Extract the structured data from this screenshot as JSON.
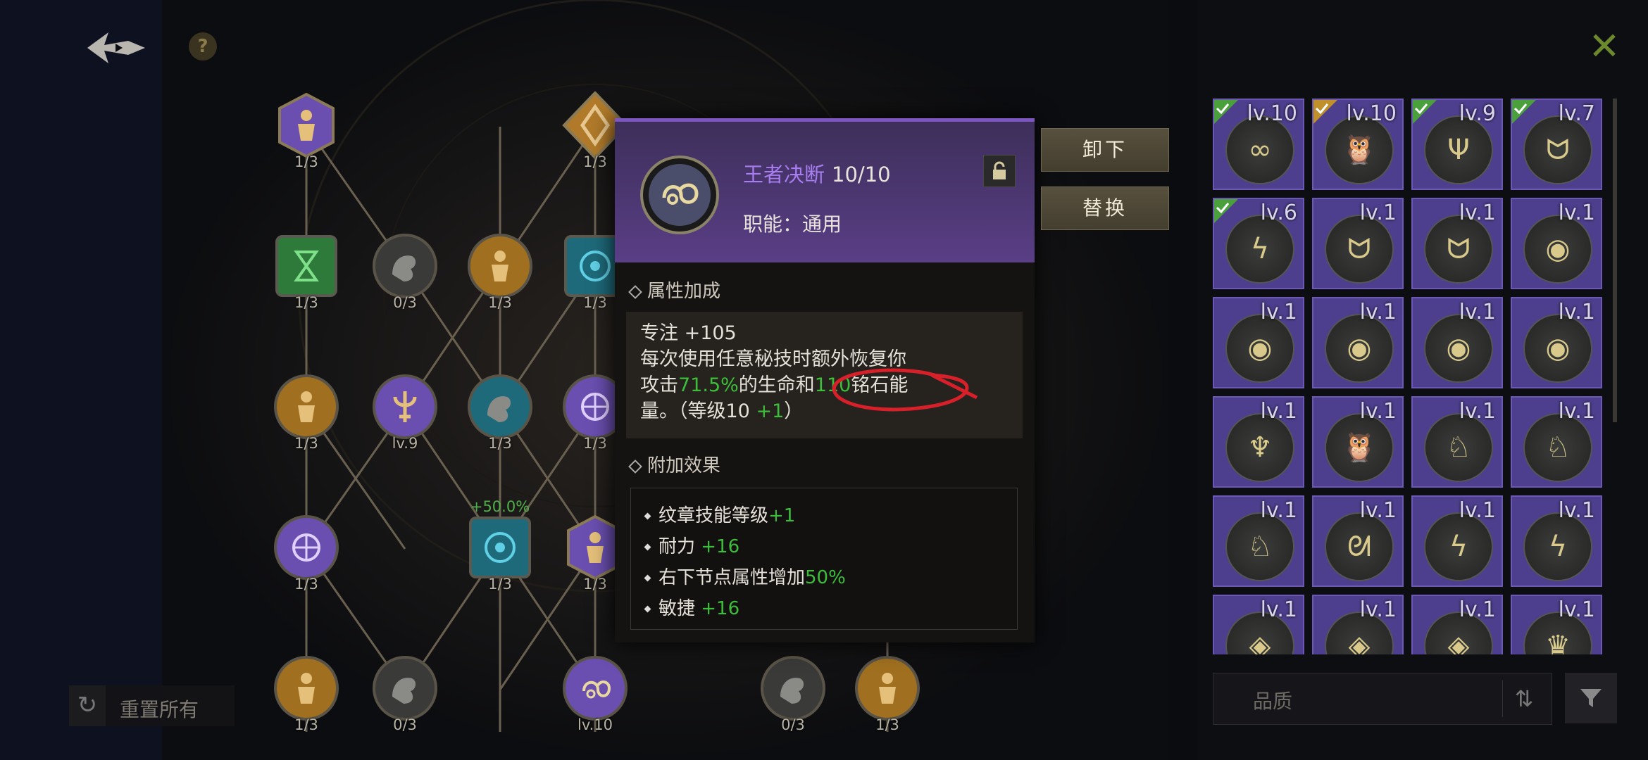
{
  "header": {
    "help_label": "?",
    "close_label": "✕"
  },
  "tree_nodes": [
    {
      "label": "1/3",
      "type": "figure",
      "color": "#6a4fb0"
    },
    {
      "label": "1/3",
      "type": "diamond",
      "color": "#b07a2a"
    },
    {
      "label": "1/3",
      "type": "hourglass",
      "color": "#2e7a3a"
    },
    {
      "label": "0/3",
      "type": "arm",
      "color": "#3a3a38"
    },
    {
      "label": "1/3",
      "type": "figure",
      "color": "#a07020"
    },
    {
      "label": "1/3",
      "type": "target",
      "color": "#1e6a7a"
    },
    {
      "label": "1/3",
      "type": "figure",
      "color": "#a07020"
    },
    {
      "label": "lv.9",
      "type": "trident",
      "color": "#6a4fb0"
    },
    {
      "label": "1/3",
      "type": "arm",
      "color": "#1e6a7a"
    },
    {
      "label": "1/3",
      "type": "compass",
      "color": "#6a4fb0"
    },
    {
      "label": "1/3",
      "type": "compass",
      "color": "#6a4fb0"
    },
    {
      "label": "1/3",
      "type": "target",
      "color": "#1e6a7a",
      "bonus": "+50.0%"
    },
    {
      "label": "1/3",
      "type": "figure",
      "color": "#6a4fb0"
    },
    {
      "label": "1/3",
      "type": "figure",
      "color": "#a07020"
    },
    {
      "label": "0/3",
      "type": "arm",
      "color": "#3a3a38"
    },
    {
      "label": "lv.10",
      "type": "swirl",
      "color": "#6a4fb0"
    },
    {
      "label": "0/3",
      "type": "arm",
      "color": "#3a3a38"
    },
    {
      "label": "1/3",
      "type": "figure",
      "color": "#a07020"
    }
  ],
  "reset": {
    "label": "重置所有"
  },
  "popup": {
    "name": "王者决断",
    "level": "10/10",
    "role": "职能：通用",
    "lock_icon": "lock-icon",
    "attr_title": "属性加成",
    "attr_focus": "专注 +105",
    "attr_desc_1": "每次使用任意秘技时额外恢复你",
    "attr_desc_2a": "攻击",
    "attr_desc_2b": "71.5%",
    "attr_desc_2c": "的生命和",
    "attr_desc_2d": "110",
    "attr_desc_2e": "铭石能",
    "attr_desc_3a": "量。（等级10 ",
    "attr_desc_3b": "+1",
    "attr_desc_3c": "）",
    "effect_title": "附加效果",
    "effects": [
      {
        "text": "纹章技能等级",
        "value": "+1"
      },
      {
        "text": "耐力 ",
        "value": "+16"
      },
      {
        "text": "右下节点属性增加",
        "value": "50%"
      },
      {
        "text": "敏捷 ",
        "value": "+16"
      }
    ]
  },
  "actions": {
    "unequip": "卸下",
    "replace": "替换"
  },
  "inventory": [
    {
      "level": "lv.10",
      "glyph": "swirl",
      "check": "#4aa03a"
    },
    {
      "level": "lv.10",
      "glyph": "owl",
      "check": "#c0902a"
    },
    {
      "level": "lv.9",
      "glyph": "trident",
      "check": "#4aa03a"
    },
    {
      "level": "lv.7",
      "glyph": "horns",
      "check": "#4aa03a"
    },
    {
      "level": "lv.6",
      "glyph": "bolt",
      "check": "#4aa03a"
    },
    {
      "level": "lv.1",
      "glyph": "horns"
    },
    {
      "level": "lv.1",
      "glyph": "horns"
    },
    {
      "level": "lv.1",
      "glyph": "eye"
    },
    {
      "level": "lv.1",
      "glyph": "eye"
    },
    {
      "level": "lv.1",
      "glyph": "eye"
    },
    {
      "level": "lv.1",
      "glyph": "eye"
    },
    {
      "level": "lv.1",
      "glyph": "eye"
    },
    {
      "level": "lv.1",
      "glyph": "tree"
    },
    {
      "level": "lv.1",
      "glyph": "owl"
    },
    {
      "level": "lv.1",
      "glyph": "bird"
    },
    {
      "level": "lv.1",
      "glyph": "bird"
    },
    {
      "level": "lv.1",
      "glyph": "bird"
    },
    {
      "level": "lv.1",
      "glyph": "wing"
    },
    {
      "level": "lv.1",
      "glyph": "bolt"
    },
    {
      "level": "lv.1",
      "glyph": "bolt"
    },
    {
      "level": "lv.1",
      "glyph": "diamond"
    },
    {
      "level": "lv.1",
      "glyph": "diamond"
    },
    {
      "level": "lv.1",
      "glyph": "diamond"
    },
    {
      "level": "lv.1",
      "glyph": "crown"
    }
  ],
  "quality": {
    "label": "品质"
  },
  "colors": {
    "accent": "#7e56c4",
    "green": "#3dbe3a",
    "card": "#4e3f8e",
    "gold": "#9a8450"
  }
}
